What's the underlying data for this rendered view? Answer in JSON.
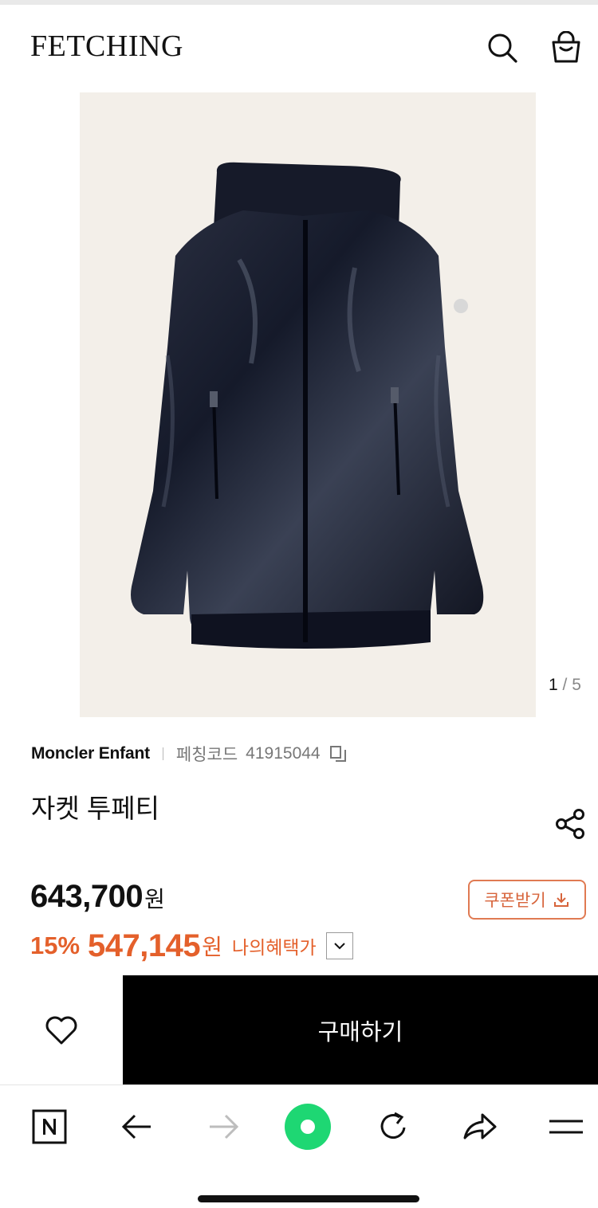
{
  "header": {
    "logo": "FETCHING",
    "icons": [
      "search-icon",
      "shopping-bag-icon"
    ]
  },
  "gallery": {
    "current": "1",
    "separator": "/",
    "total": "5"
  },
  "product": {
    "brand": "Moncler Enfant",
    "code_label": "페칭코드",
    "code_value": "41915044",
    "name": "자켓 투페티",
    "price": "643,700",
    "price_unit": "원",
    "discount_rate": "15%",
    "discount_price": "547,145",
    "discount_unit": "원",
    "benefit_label": "나의혜택가"
  },
  "coupon": {
    "label": "쿠폰받기"
  },
  "purchase": {
    "buy_label": "구매하기"
  },
  "browser_toolbar": {
    "icons": [
      "naver-n-icon",
      "back-arrow-icon",
      "forward-arrow-icon",
      "green-dot-icon",
      "refresh-icon",
      "share-arrow-icon",
      "menu-icon"
    ]
  },
  "colors": {
    "accent": "#e4602b",
    "coupon_border": "#e07a52",
    "buy_bg": "#000000",
    "image_bg": "#f3efe9",
    "green": "#1ed773"
  }
}
